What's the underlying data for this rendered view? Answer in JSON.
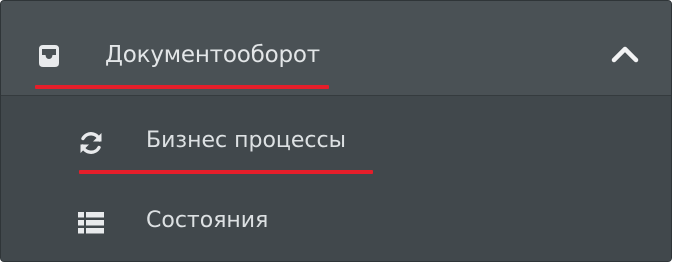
{
  "menu": {
    "section": {
      "label": "Документооборот",
      "icon": "inbox-icon",
      "expanded": true,
      "chevron_icon": "chevron-up-icon"
    },
    "items": [
      {
        "label": "Бизнес процессы",
        "icon": "sync-icon",
        "highlighted": true
      },
      {
        "label": "Состояния",
        "icon": "list-icon",
        "highlighted": false
      }
    ]
  },
  "colors": {
    "background": "#40474b",
    "header_background": "#4a5155",
    "text": "#e3e6e8",
    "icon": "#e8eaec",
    "highlight_underline": "#e61e2a"
  }
}
